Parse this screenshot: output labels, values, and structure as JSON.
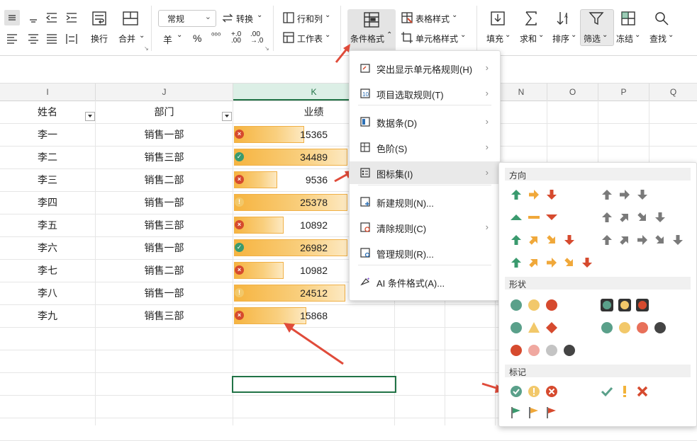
{
  "ribbon": {
    "font_size": "常规",
    "convert": "转换",
    "rowcol": "行和列",
    "worksheet": "工作表",
    "wrap": "换行",
    "merge": "合并",
    "cond_format": "条件格式",
    "table_style": "表格样式",
    "cell_style": "单元格样式",
    "fill": "填充",
    "sum": "求和",
    "sort": "排序",
    "filter": "筛选",
    "freeze": "冻结",
    "find": "查找",
    "currency_symbol": "羊",
    "percent": "%"
  },
  "sheet": {
    "columns": [
      "I",
      "J",
      "K",
      "L",
      "M",
      "N",
      "O",
      "P",
      "Q"
    ],
    "headers": {
      "name": "姓名",
      "dept": "部门",
      "perf": "业绩"
    },
    "rows": [
      {
        "name": "李一",
        "dept": "销售一部",
        "value": "15365",
        "icon": "x"
      },
      {
        "name": "李二",
        "dept": "销售三部",
        "value": "34489",
        "icon": "check"
      },
      {
        "name": "李三",
        "dept": "销售二部",
        "value": "9536",
        "icon": "x"
      },
      {
        "name": "李四",
        "dept": "销售一部",
        "value": "25378",
        "icon": "excl"
      },
      {
        "name": "李五",
        "dept": "销售三部",
        "value": "10892",
        "icon": "x"
      },
      {
        "name": "李六",
        "dept": "销售一部",
        "value": "26982",
        "icon": "check"
      },
      {
        "name": "李七",
        "dept": "销售二部",
        "value": "10982",
        "icon": "x"
      },
      {
        "name": "李八",
        "dept": "销售一部",
        "value": "24512",
        "icon": "excl"
      },
      {
        "name": "李九",
        "dept": "销售三部",
        "value": "15868",
        "icon": "x"
      }
    ],
    "bar_fraction": [
      0.62,
      1.0,
      0.38,
      1.0,
      0.44,
      1.0,
      0.44,
      0.98,
      0.64
    ]
  },
  "menu": {
    "items": [
      {
        "label": "突出显示单元格规则(H)",
        "arrow": "›",
        "icon": "highlight-rules-icon"
      },
      {
        "label": "项目选取规则(T)",
        "arrow": "›",
        "icon": "top-bottom-rules-icon"
      },
      {
        "label": "数据条(D)",
        "arrow": "›",
        "icon": "data-bars-icon"
      },
      {
        "label": "色阶(S)",
        "arrow": "›",
        "icon": "color-scales-icon"
      },
      {
        "label": "图标集(I)",
        "arrow": "›",
        "icon": "icon-sets-icon"
      },
      {
        "label": "新建规则(N)...",
        "arrow": "",
        "icon": "new-rule-icon"
      },
      {
        "label": "清除规则(C)",
        "arrow": "›",
        "icon": "clear-rules-icon"
      },
      {
        "label": "管理规则(R)...",
        "arrow": "",
        "icon": "manage-rules-icon"
      },
      {
        "label": "AI 条件格式(A)...",
        "arrow": "",
        "icon": "ai-icon"
      }
    ]
  },
  "submenu": {
    "sections": {
      "direction": "方向",
      "shape": "形状",
      "mark": "标记"
    }
  },
  "colors": {
    "green": "#3a9a6e",
    "orange": "#f0a83a",
    "red": "#d64a2e",
    "gray": "#7a7a7a",
    "accent": "#217346"
  }
}
